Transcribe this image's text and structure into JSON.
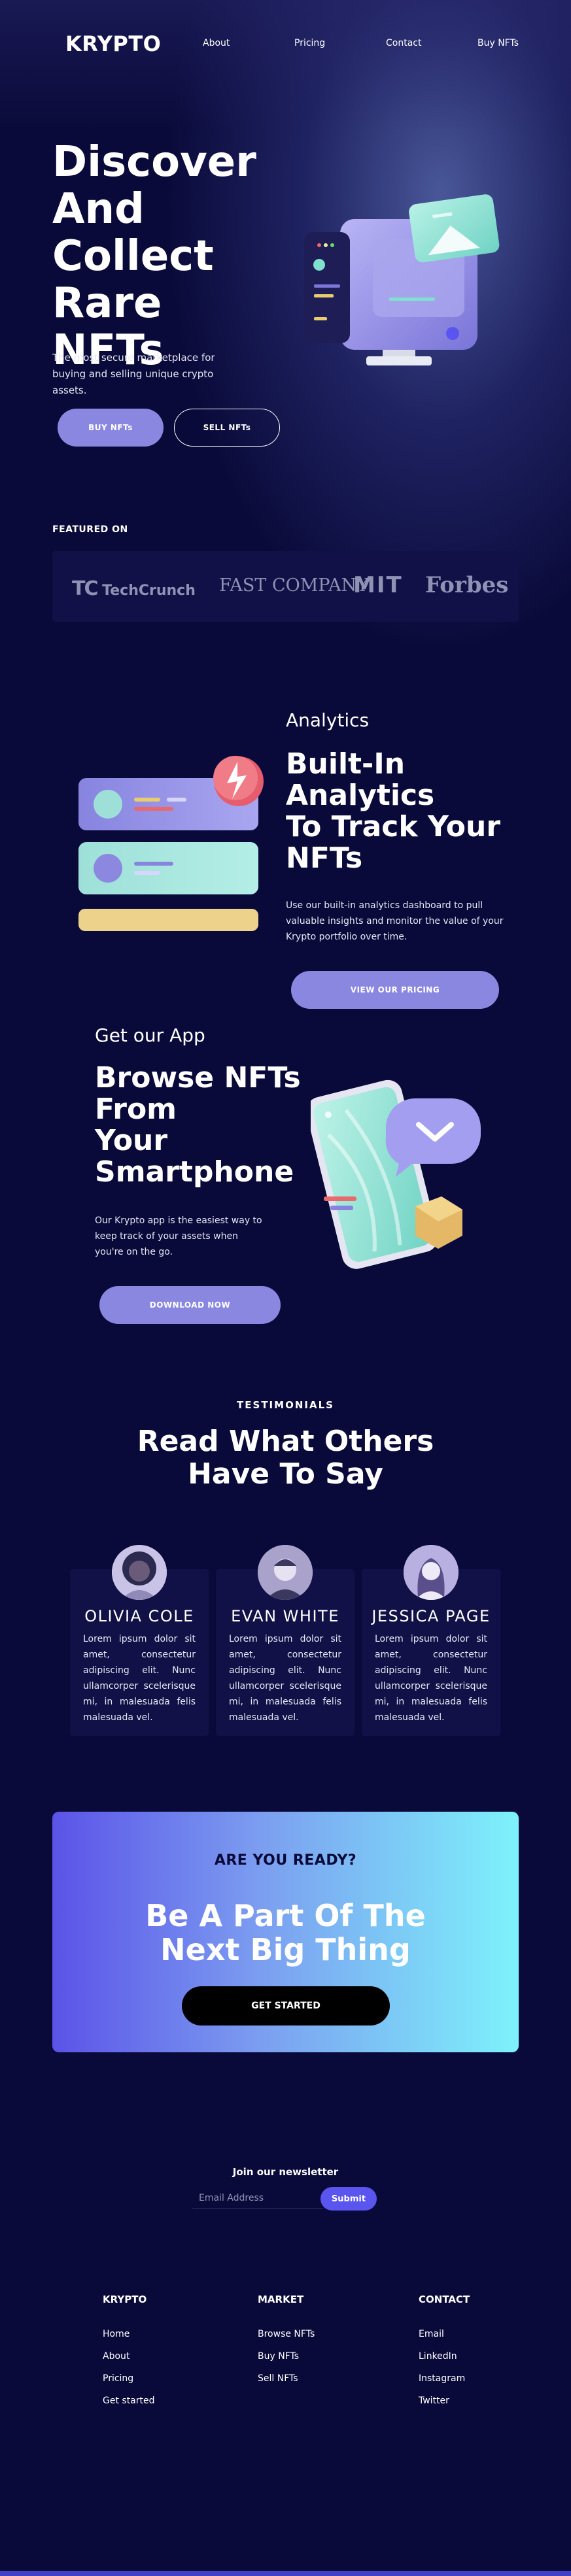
{
  "brand": "KRYPTO",
  "nav": [
    "About",
    "Pricing",
    "Contact",
    "Buy NFTs"
  ],
  "hero": {
    "title_lines": [
      "Discover",
      "And",
      "Collect",
      "Rare NFTs"
    ],
    "subtitle": "The most secure marketplace for buying and selling unique crypto assets.",
    "primary_btn": "BUY NFTs",
    "secondary_btn": "SELL NFTs"
  },
  "featured": {
    "label": "FEATURED ON",
    "logos": [
      "TechCrunch",
      "FAST COMPANY",
      "MIT",
      "Forbes"
    ]
  },
  "analytics": {
    "kicker": "Analytics",
    "title_lines": [
      "Built-In",
      "Analytics",
      "To Track Your",
      "NFTs"
    ],
    "body": "Use our built-in analytics dashboard to pull valuable insights and monitor the value of your Krypto portfolio over time.",
    "btn": "VIEW OUR PRICING"
  },
  "app": {
    "kicker": "Get our App",
    "title_lines": [
      "Browse NFTs",
      "From",
      "Your",
      "Smartphone"
    ],
    "body": "Our Krypto app is the easiest way to keep track of your assets when you're on the go.",
    "btn": "DOWNLOAD NOW"
  },
  "testimonials": {
    "kicker": "TESTIMONIALS",
    "title_lines": [
      "Read What Others",
      "Have To Say"
    ],
    "items": [
      {
        "name": "OLIVIA COLE",
        "quote": "Lorem ipsum dolor sit amet, consectetur adipiscing elit. Nunc ullamcorper scelerisque mi, in malesuada felis malesuada vel."
      },
      {
        "name": "EVAN WHITE",
        "quote": "Lorem ipsum dolor sit amet, consectetur adipiscing elit. Nunc ullamcorper scelerisque mi, in malesuada felis malesuada vel."
      },
      {
        "name": "JESSICA PAGE",
        "quote": "Lorem ipsum dolor sit amet, consectetur adipiscing elit. Nunc ullamcorper scelerisque mi, in malesuada felis malesuada vel."
      }
    ]
  },
  "cta": {
    "kicker": "ARE YOU READY?",
    "title_lines": [
      "Be A Part Of The",
      "Next Big Thing"
    ],
    "btn": "GET STARTED"
  },
  "newsletter": {
    "title": "Join our newsletter",
    "placeholder": "Email Address",
    "btn": "Submit"
  },
  "footer": {
    "columns": [
      {
        "heading": "KRYPTO",
        "links": [
          "Home",
          "About",
          "Pricing",
          "Get started"
        ]
      },
      {
        "heading": "MARKET",
        "links": [
          "Browse NFTs",
          "Buy NFTs",
          "Sell NFTs"
        ]
      },
      {
        "heading": "CONTACT",
        "links": [
          "Email",
          "LinkedIn",
          "Instagram",
          "Twitter"
        ]
      }
    ]
  },
  "colors": {
    "background": "#0a0a3a",
    "accent": "#8a87e0",
    "card": "#111147",
    "submit": "#5b55f0"
  }
}
